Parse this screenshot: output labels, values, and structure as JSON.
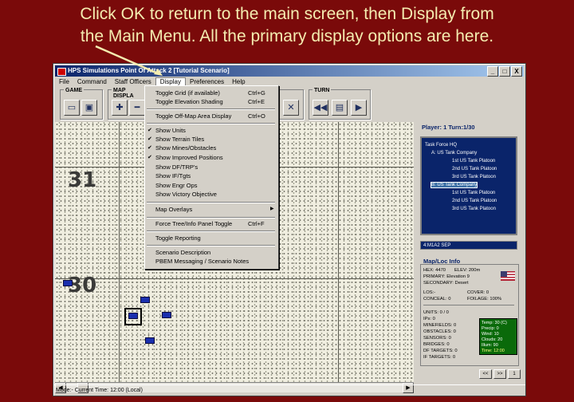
{
  "caption": {
    "line1": "Click OK to return to the main screen, then Display from",
    "line2": "the Main Menu.  All the primary display options are here."
  },
  "window": {
    "title": "HPS Simulations Point Of Attack 2 [Tutorial Scenario]",
    "buttons": [
      "_",
      "□",
      "X"
    ]
  },
  "menubar": [
    "File",
    "Command",
    "Staff Officers",
    "Display",
    "Preferences",
    "Help"
  ],
  "toolbar": {
    "groups": [
      "GAME",
      "MAP DISPLA",
      "TURN"
    ]
  },
  "display_menu": {
    "items": [
      {
        "label": "Toggle Grid (if available)",
        "shortcut": "Ctrl+G"
      },
      {
        "label": "Toggle Elevation Shading",
        "shortcut": "Ctrl+E"
      },
      {
        "label": "Toggle Off-Map Area Display",
        "shortcut": "Ctrl+O"
      },
      {
        "label": "Show Units",
        "checked": true
      },
      {
        "label": "Show Terrain Tiles",
        "checked": true
      },
      {
        "label": "Show Mines/Obstacles",
        "checked": true
      },
      {
        "label": "Show Improved Positions",
        "checked": true
      },
      {
        "label": "Show DF/TRP's"
      },
      {
        "label": "Show IF/Tgts"
      },
      {
        "label": "Show Engr Ops"
      },
      {
        "label": "Show Victory Objective"
      },
      {
        "label": "Map Overlays",
        "submenu": true
      },
      {
        "label": "Force Tree/Info Panel Toggle",
        "shortcut": "Ctrl+F"
      },
      {
        "label": "Toggle Reporting"
      },
      {
        "label": "Scenario Description"
      },
      {
        "label": "PBEM Messaging / Scenario Notes"
      }
    ]
  },
  "map": {
    "hex_labels": [
      "31",
      "30"
    ]
  },
  "side_panel": {
    "player_turn": "Player: 1   Turn:1/30",
    "tree": [
      "Task Force HQ",
      "A: US Tank Company",
      "1st US Tank Platoon",
      "2nd US Tank Platoon",
      "3rd US Tank Platoon",
      "B: US Tank Company",
      "1st US Tank Platoon",
      "2nd US Tank Platoon",
      "3rd US Tank Platoon"
    ],
    "selected_unit": "4:M1A2 SEP",
    "info_title": "Map/Loc Info",
    "hex": "HEX: 4470",
    "elev": "ELEV: 200m",
    "primary": "PRIMARY: Elevation 9",
    "secondary": "SECONDARY: Desert",
    "los": "LOS:-",
    "cover": "COVER: 0",
    "conceal": "CONCEAL: 0",
    "foliage": "FOILAGE: 100%",
    "units": "UNITS: 0 / 0",
    "ips": "IPs: 0",
    "minefields": "MINEFIELDS: 0",
    "obstacles": "OBSTACLES: 0",
    "sensors": "SENSORS: 0",
    "bridges": "BRIDGES: 0",
    "df_targets": "DF TARGETS: 0",
    "if_targets": "IF TARGETS: 0",
    "weather": {
      "temp": "Temp: 30 (C)",
      "precip": "Precip: 0",
      "wind": "Wind: 10",
      "clouds": "Clouds: 20",
      "illum": "Illum: 90",
      "time": "Time: 12:00"
    },
    "nav": [
      "<<",
      ">>",
      "1"
    ]
  },
  "status": "Mode:- Current Time: 12:00 (Local)",
  "colors": {
    "background": "#7a0a0a",
    "caption": "#f4ecb0",
    "titlebar": "#0a246a",
    "tree_bg": "#0a246a",
    "unit_counter": "#1a2fae"
  }
}
